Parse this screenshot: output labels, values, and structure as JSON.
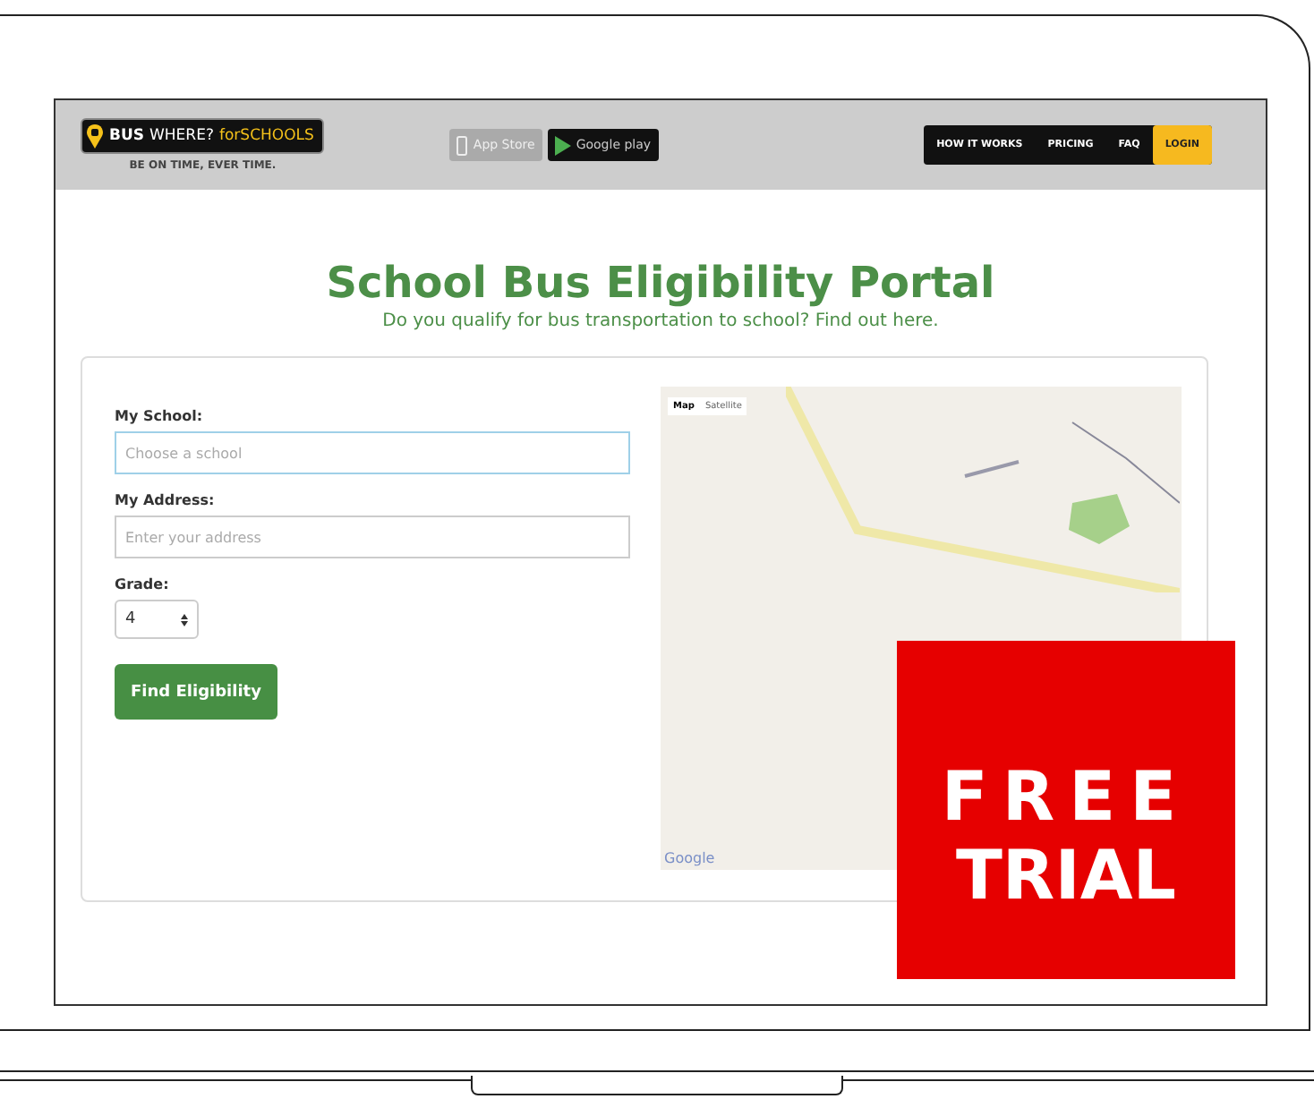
{
  "logo": {
    "word_1": "BUS",
    "word_2": "WHERE?",
    "word_3": "forSCHOOLS",
    "tagline": "BE ON TIME, EVER TIME."
  },
  "store_badges": [
    {
      "kind": "apple",
      "label": "App Store"
    },
    {
      "kind": "google",
      "label": "Google play"
    }
  ],
  "nav": [
    {
      "label": "HOW IT WORKS",
      "highlighted": false
    },
    {
      "label": "PRICING",
      "highlighted": false
    },
    {
      "label": "FAQ",
      "highlighted": false
    },
    {
      "label": "LOGIN",
      "highlighted": true
    }
  ],
  "heading": {
    "title": "School Bus Eligibility Portal",
    "subtitle": "Do you qualify for bus transportation to school? Find out here."
  },
  "form": {
    "fields": [
      {
        "label": "My School:",
        "placeholder": "Choose a school",
        "focused": true
      },
      {
        "label": "My Address:",
        "placeholder": "Enter your address",
        "focused": false
      }
    ],
    "grade": {
      "label": "Grade:",
      "value": "4"
    },
    "button": "Find Eligibility"
  },
  "map": {
    "tabs": [
      {
        "label": "Map",
        "selected": true
      },
      {
        "label": "Satellite",
        "selected": false
      }
    ],
    "attribution": "Google"
  },
  "promo": {
    "line_1": "FREE",
    "line_2": "TRIAL"
  }
}
